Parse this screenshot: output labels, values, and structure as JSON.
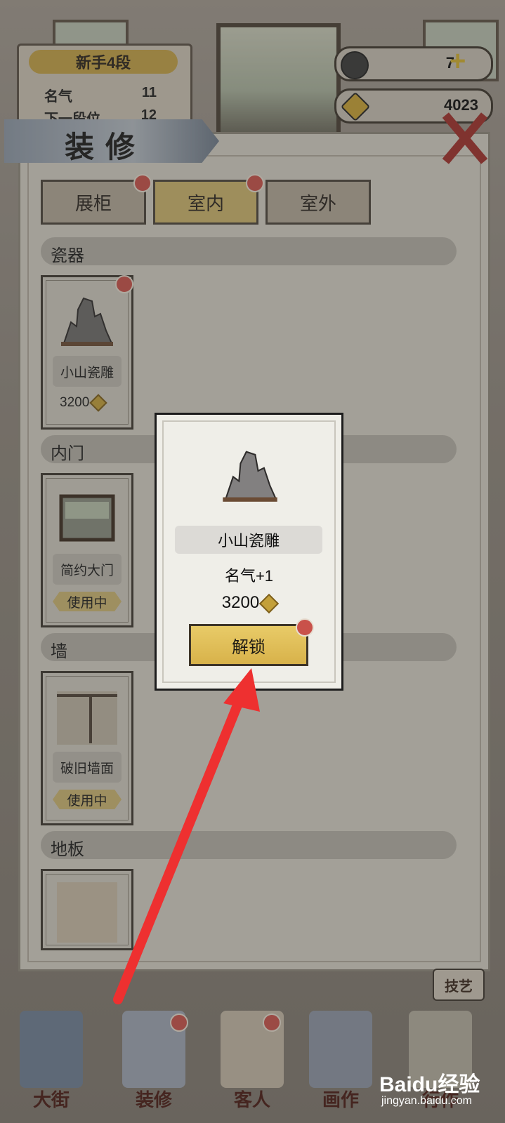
{
  "header": {
    "rank_title": "新手4段",
    "stats": [
      {
        "label": "名气",
        "value": "11"
      },
      {
        "label": "下一段位",
        "value": "12"
      }
    ],
    "resources": {
      "ink": "7",
      "coins": "4023"
    }
  },
  "panel": {
    "title": "装修",
    "tabs": [
      {
        "label": "展柜",
        "active": false,
        "dot": true
      },
      {
        "label": "室内",
        "active": true,
        "dot": true
      },
      {
        "label": "室外",
        "active": false,
        "dot": false
      }
    ],
    "sections": [
      {
        "label": "瓷器",
        "item": {
          "name": "小山瓷雕",
          "price": "3200",
          "status": ""
        }
      },
      {
        "label": "内门",
        "item": {
          "name": "简约大门",
          "price": "",
          "status": "使用中"
        }
      },
      {
        "label": "墙",
        "item": {
          "name": "破旧墙面",
          "price": "",
          "status": "使用中"
        }
      },
      {
        "label": "地板",
        "item": {
          "name": "",
          "price": "",
          "status": ""
        }
      }
    ]
  },
  "popup": {
    "name": "小山瓷雕",
    "fame": "名气+1",
    "price": "3200",
    "button": "解锁"
  },
  "bottom_nav": {
    "items": [
      {
        "label": "大街"
      },
      {
        "label": "装修"
      },
      {
        "label": "客人"
      },
      {
        "label": "画作"
      },
      {
        "label": "行作"
      }
    ],
    "skill": "技艺"
  },
  "watermark": {
    "brand": "Baidu经验",
    "url": "jingyan.baidu.com"
  },
  "colors": {
    "accent_gold": "#cdb56e",
    "alert_red": "#c9514a",
    "close_red": "#a1302b",
    "arrow_red": "#ee3030"
  }
}
